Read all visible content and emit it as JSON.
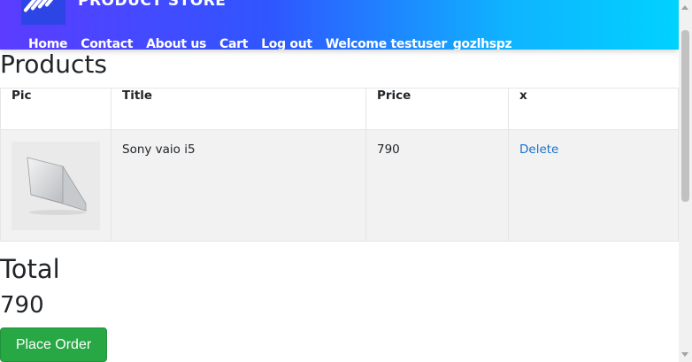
{
  "header": {
    "brand": "PRODUCT STORE",
    "nav": {
      "home": "Home",
      "contact": "Contact",
      "about": "About us",
      "cart": "Cart",
      "logout": "Log out",
      "welcome": "Welcome testuser_gozlhspz"
    }
  },
  "page_title": "Products",
  "table": {
    "headers": {
      "pic": "Pic",
      "title": "Title",
      "price": "Price",
      "action": "x"
    },
    "rows": [
      {
        "title": "Sony vaio i5",
        "price": "790",
        "action": "Delete"
      }
    ]
  },
  "total": {
    "label": "Total",
    "value": "790"
  },
  "place_order_label": "Place Order",
  "colors": {
    "nav_start": "#5c3cff",
    "nav_end": "#00d2ff",
    "button": "#28a745",
    "link": "#1a73c8"
  }
}
